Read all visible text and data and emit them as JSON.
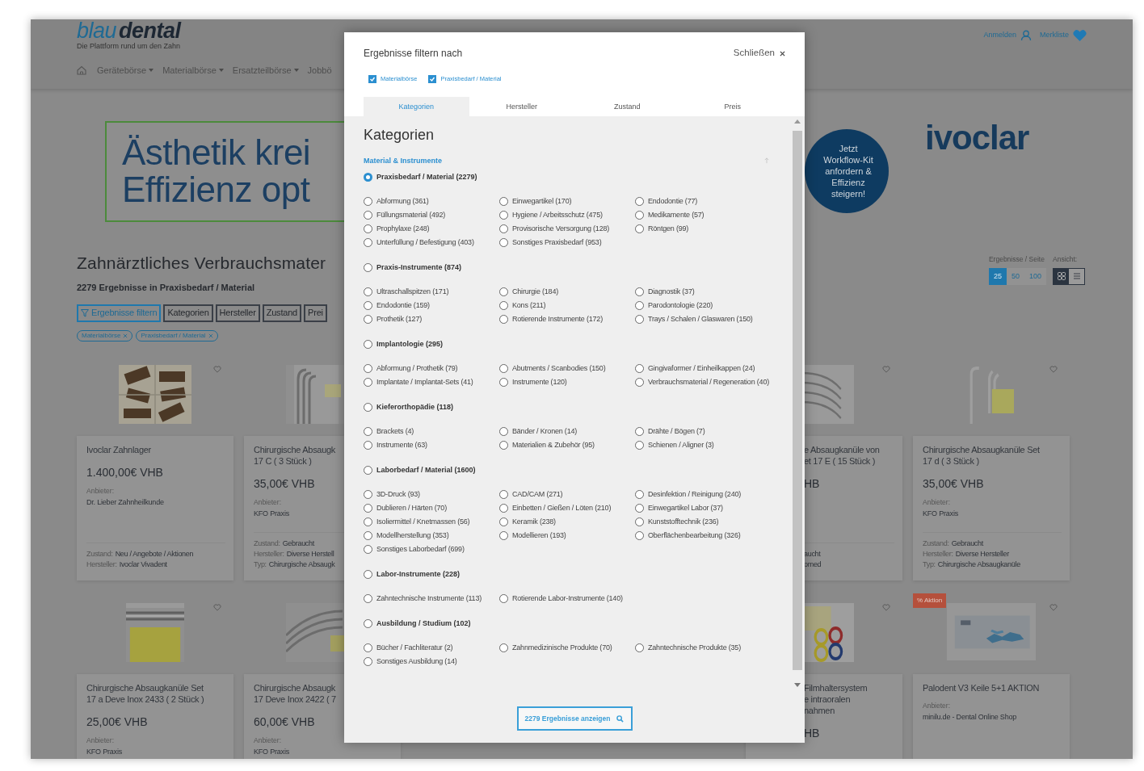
{
  "header": {
    "logo": [
      "blau",
      "dental"
    ],
    "tagline": "Die Plattform rund um den Zahn",
    "nav": [
      {
        "label": "Gerätebörse",
        "dropdown": true
      },
      {
        "label": "Materialbörse",
        "dropdown": true
      },
      {
        "label": "Ersatzteilbörse",
        "dropdown": true
      },
      {
        "label": "Jobbö",
        "dropdown": false
      }
    ],
    "account": [
      {
        "label": "Anmelden",
        "kind": "user"
      },
      {
        "label": "Merkliste",
        "kind": "heart"
      }
    ]
  },
  "banner": {
    "headline_lines": [
      "Ästhetik krei",
      "Effizienz opt"
    ],
    "badge_lines": [
      "Jetzt",
      "Workflow-Kit",
      "anfordern &",
      "Effizienz",
      "steigern!"
    ],
    "brand": "ivoclar"
  },
  "listing": {
    "title": "Zahnärztliches Verbrauchsmater",
    "result_count": "2279 Ergebnisse in Praxisbedarf / Material",
    "filter_buttons": [
      {
        "label": "Ergebnisse filtern",
        "kind": "primary"
      },
      {
        "label": "Kategorien",
        "kind": "plain"
      },
      {
        "label": "Hersteller",
        "kind": "plain"
      },
      {
        "label": "Zustand",
        "kind": "plain"
      },
      {
        "label": "Prei",
        "kind": "plain"
      }
    ],
    "chips": [
      "Materialbörse",
      "Praxisbedarf / Material"
    ],
    "per_page_label": "Ergebnisse / Seite",
    "view_label": "Ansicht:",
    "per_page_options": [
      {
        "label": "25",
        "selected": true
      },
      {
        "label": "50",
        "selected": false
      },
      {
        "label": "100",
        "selected": false
      }
    ],
    "view_options": [
      {
        "kind": "grid",
        "selected": true
      },
      {
        "kind": "list",
        "selected": false
      }
    ]
  },
  "product_rows": [
    [
      {
        "title_lines": [
          "Ivoclar Zahnlager"
        ],
        "price": "1.400,00€ VHB",
        "seller_label": "Anbieter:",
        "seller": "Dr. Lieber Zahnheilkunde",
        "details": [
          {
            "label": "Zustand:",
            "value": "Neu / Angebote / Aktionen"
          },
          {
            "label": "Hersteller:",
            "value": "Ivoclar Vivadent"
          }
        ]
      },
      {
        "title_lines": [
          "Chirurgische Absaugk",
          "17 C ( 3 Stück )"
        ],
        "price": "35,00€ VHB",
        "seller_label": "Anbieter:",
        "seller": "KFO Praxis",
        "details": [
          {
            "label": "Zustand:",
            "value": "Gebraucht"
          },
          {
            "label": "Hersteller:",
            "value": "Diverse Herstell"
          },
          {
            "label": "Typ:",
            "value": "Chirurgische Absaugk"
          }
        ]
      },
      {
        "title_lines": [
          "e Absaugkanüle von",
          "et 17 E ( 15 Stück )"
        ],
        "price": "HB",
        "details": [
          {
            "value": "aucht"
          },
          {
            "value": "omed"
          }
        ]
      },
      {
        "title_lines": [
          "Chirurgische Absaugkanüle Set",
          "17 d ( 3 Stück )"
        ],
        "price": "35,00€ VHB",
        "seller_label": "Anbieter:",
        "seller": "KFO Praxis",
        "details": [
          {
            "label": "Zustand:",
            "value": "Gebraucht"
          },
          {
            "label": "Hersteller:",
            "value": "Diverse Hersteller"
          },
          {
            "label": "Typ:",
            "value": "Chirurgische Absaugkanüle"
          }
        ]
      }
    ],
    [
      {
        "title_lines": [
          "Chirurgische Absaugkanüle Set",
          "17 a Deve Inox 2433 ( 2 Stück )"
        ],
        "price": "25,00€ VHB",
        "seller_label": "Anbieter:",
        "seller": "KFO Praxis"
      },
      {
        "title_lines": [
          "Chirurgische Absaugk",
          "17 Deve Inox 2422 ( 7"
        ],
        "price": "60,00€ VHB",
        "seller_label": "Anbieter:",
        "seller": "KFO Praxis"
      },
      {
        "title_lines": [
          "Filmhaltersystem",
          "e intraoralen",
          "nahmen"
        ],
        "price": "HB"
      },
      {
        "badge": "% Aktion",
        "title_lines": [
          "Palodent V3 Keile 5+1 AKTION"
        ],
        "seller_label": "Anbieter:",
        "seller": "minilu.de - Dental Online Shop"
      }
    ]
  ],
  "modal": {
    "title": "Ergebnisse filtern nach",
    "close_label": "Schließen",
    "active_filters": [
      {
        "label": "Materialbörse",
        "checked": true
      },
      {
        "label": "Praxisbedarf / Material",
        "checked": true
      }
    ],
    "tabs": [
      {
        "label": "Kategorien",
        "selected": true
      },
      {
        "label": "Hersteller",
        "selected": false
      },
      {
        "label": "Zustand",
        "selected": false
      },
      {
        "label": "Preis",
        "selected": false
      }
    ],
    "heading": "Kategorien",
    "section_link": "Material & Instrumente",
    "groups": [
      {
        "label": "Praxisbedarf / Material (2279)",
        "selected": true,
        "children": [
          {
            "label": "Abformung (361)",
            "selected": false
          },
          {
            "label": "Einwegartikel (170)",
            "selected": false
          },
          {
            "label": "Endodontie (77)",
            "selected": false
          },
          {
            "label": "Füllungsmaterial (492)",
            "selected": false
          },
          {
            "label": "Hygiene / Arbeitsschutz (475)",
            "selected": false
          },
          {
            "label": "Medikamente (57)",
            "selected": false
          },
          {
            "label": "Prophylaxe (248)",
            "selected": false
          },
          {
            "label": "Provisorische Versorgung (128)",
            "selected": false
          },
          {
            "label": "Röntgen (99)",
            "selected": false
          },
          {
            "label": "Unterfüllung / Befestigung (403)",
            "selected": false
          },
          {
            "label": "Sonstiges Praxisbedarf (953)",
            "selected": false
          }
        ]
      },
      {
        "label": "Praxis-Instrumente (874)",
        "selected": false,
        "children": [
          {
            "label": "Ultraschallspitzen (171)",
            "selected": false
          },
          {
            "label": "Chirurgie (184)",
            "selected": false
          },
          {
            "label": "Diagnostik (37)",
            "selected": false
          },
          {
            "label": "Endodontie (159)",
            "selected": false
          },
          {
            "label": "Kons (211)",
            "selected": false
          },
          {
            "label": "Parodontologie (220)",
            "selected": false
          },
          {
            "label": "Prothetik (127)",
            "selected": false
          },
          {
            "label": "Rotierende Instrumente (172)",
            "selected": false
          },
          {
            "label": "Trays / Schalen / Glaswaren (150)",
            "selected": false
          }
        ]
      },
      {
        "label": "Implantologie (295)",
        "selected": false,
        "children": [
          {
            "label": "Abformung / Prothetik (79)",
            "selected": false
          },
          {
            "label": "Abutments / Scanbodies (150)",
            "selected": false
          },
          {
            "label": "Gingivaformer / Einheilkappen (24)",
            "selected": false
          },
          {
            "label": "Implantate / Implantat-Sets (41)",
            "selected": false
          },
          {
            "label": "Instrumente (120)",
            "selected": false
          },
          {
            "label": "Verbrauchsmaterial / Regeneration (40)",
            "selected": false
          }
        ]
      },
      {
        "label": "Kieferorthopädie (118)",
        "selected": false,
        "children": [
          {
            "label": "Brackets (4)",
            "selected": false
          },
          {
            "label": "Bänder / Kronen (14)",
            "selected": false
          },
          {
            "label": "Drähte / Bögen (7)",
            "selected": false
          },
          {
            "label": "Instrumente (63)",
            "selected": false
          },
          {
            "label": "Materialien & Zubehör (95)",
            "selected": false
          },
          {
            "label": "Schienen / Aligner (3)",
            "selected": false
          }
        ]
      },
      {
        "label": "Laborbedarf / Material (1600)",
        "selected": false,
        "children": [
          {
            "label": "3D-Druck (93)",
            "selected": false
          },
          {
            "label": "CAD/CAM (271)",
            "selected": false
          },
          {
            "label": "Desinfektion / Reinigung (240)",
            "selected": false
          },
          {
            "label": "Dublieren / Härten (70)",
            "selected": false
          },
          {
            "label": "Einbetten / Gießen / Löten (210)",
            "selected": false
          },
          {
            "label": "Einwegartikel Labor (37)",
            "selected": false
          },
          {
            "label": "Isoliermittel / Knetmassen (56)",
            "selected": false
          },
          {
            "label": "Keramik (238)",
            "selected": false
          },
          {
            "label": "Kunststofftechnik (236)",
            "selected": false
          },
          {
            "label": "Modellherstellung (353)",
            "selected": false
          },
          {
            "label": "Modellieren (193)",
            "selected": false
          },
          {
            "label": "Oberflächenbearbeitung (326)",
            "selected": false
          },
          {
            "label": "Sonstiges Laborbedarf (699)",
            "selected": false
          }
        ]
      },
      {
        "label": "Labor-Instrumente (228)",
        "selected": false,
        "children": [
          {
            "label": "Zahntechnische Instrumente (113)",
            "selected": false
          },
          {
            "label": "Rotierende Labor-Instrumente (140)",
            "selected": false
          }
        ]
      },
      {
        "label": "Ausbildung / Studium (102)",
        "selected": false,
        "children": [
          {
            "label": "Bücher / Fachliteratur (2)",
            "selected": false
          },
          {
            "label": "Zahnmedizinische Produkte (70)",
            "selected": false
          },
          {
            "label": "Zahntechnische Produkte (35)",
            "selected": false
          },
          {
            "label": "Sonstiges Ausbildung (14)",
            "selected": false
          }
        ]
      }
    ],
    "submit_label": "2279 Ergebnisse anzeigen"
  }
}
